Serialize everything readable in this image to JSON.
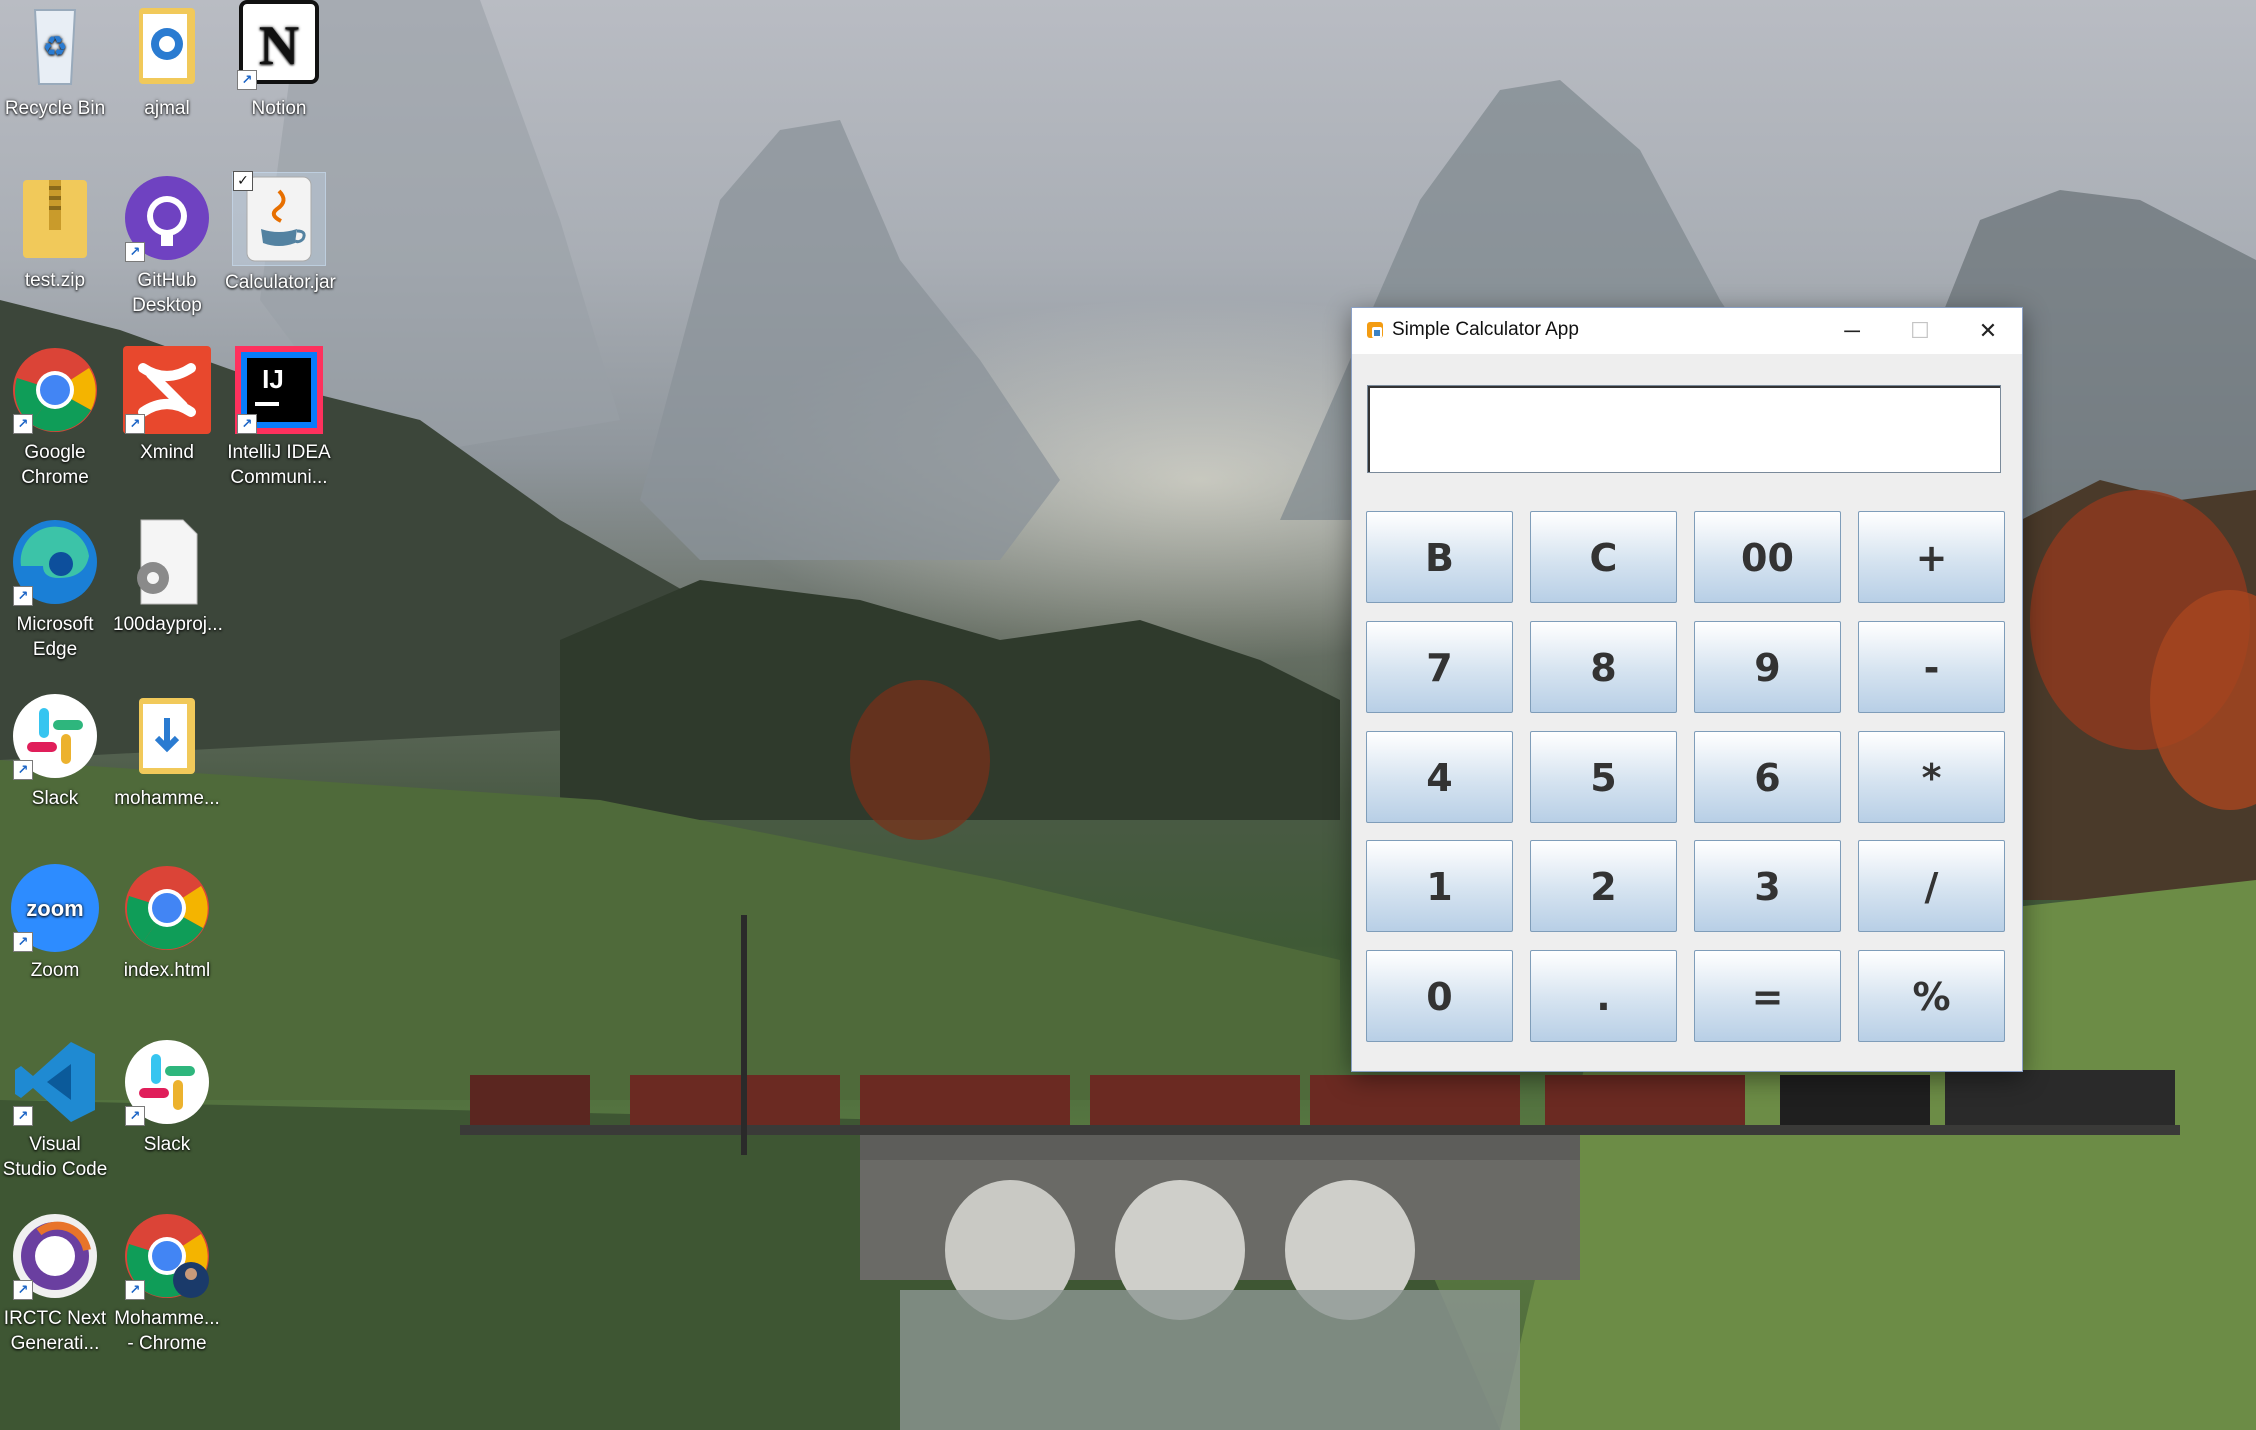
{
  "desktop": {
    "icons": [
      {
        "label": "Recycle Bin",
        "icon": "recycle-bin-icon",
        "shortcut": false
      },
      {
        "label": "ajmal",
        "icon": "user-folder-icon",
        "shortcut": false
      },
      {
        "label": "Notion",
        "icon": "notion-icon",
        "shortcut": true
      },
      {
        "label": "test.zip",
        "icon": "zip-folder-icon",
        "shortcut": false
      },
      {
        "label": "GitHub Desktop",
        "icon": "github-desktop-icon",
        "shortcut": true
      },
      {
        "label": "Calculator.jar",
        "icon": "java-jar-icon",
        "shortcut": false,
        "checked": true
      },
      {
        "label": "Google Chrome",
        "icon": "chrome-icon",
        "shortcut": true
      },
      {
        "label": "Xmind",
        "icon": "xmind-icon",
        "shortcut": true
      },
      {
        "label": "IntelliJ IDEA Communi...",
        "icon": "intellij-icon",
        "shortcut": true
      },
      {
        "label": "Microsoft Edge",
        "icon": "edge-icon",
        "shortcut": true
      },
      {
        "label": "100dayproj...",
        "icon": "settings-file-icon",
        "shortcut": false
      },
      {
        "label": "Slack",
        "icon": "slack-icon",
        "shortcut": true
      },
      {
        "label": "mohamme...",
        "icon": "user-folder-icon",
        "shortcut": false
      },
      {
        "label": "Zoom",
        "icon": "zoom-icon",
        "shortcut": true
      },
      {
        "label": "index.html",
        "icon": "chrome-icon",
        "shortcut": false
      },
      {
        "label": "Visual Studio Code",
        "icon": "vscode-icon",
        "shortcut": true
      },
      {
        "label": "Slack",
        "icon": "slack-icon",
        "shortcut": true
      },
      {
        "label": "IRCTC Next Generati...",
        "icon": "irctc-icon",
        "shortcut": true
      },
      {
        "label": "Mohamme... - Chrome",
        "icon": "chrome-profile-icon",
        "shortcut": true
      }
    ]
  },
  "window": {
    "title": "Simple Calculator App",
    "app_icon": "java-app-icon",
    "controls": {
      "minimize": "─",
      "maximize": "☐",
      "close": "✕"
    },
    "display_value": "",
    "keys": [
      [
        "B",
        "C",
        "00",
        "+"
      ],
      [
        "7",
        "8",
        "9",
        "-"
      ],
      [
        "4",
        "5",
        "6",
        "*"
      ],
      [
        "1",
        "2",
        "3",
        "/"
      ],
      [
        "0",
        ".",
        "=",
        "%"
      ]
    ]
  },
  "colors": {
    "key_top": "#ffffff",
    "key_bottom": "#b8cfe6",
    "key_border": "#7f9db9",
    "key_text": "#333333",
    "window_bg": "#eeeeee"
  }
}
